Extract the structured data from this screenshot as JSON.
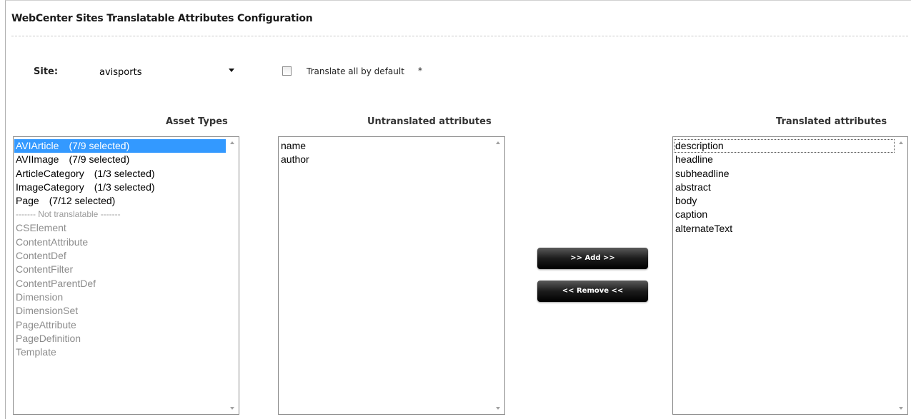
{
  "page": {
    "title": "WebCenter Sites Translatable Attributes Configuration"
  },
  "site": {
    "label": "Site:",
    "selected": "avisports"
  },
  "translate_all": {
    "label": "Translate all by default",
    "star": "*",
    "checked": false
  },
  "asset_types": {
    "header": "Asset Types",
    "translatable": [
      {
        "name": "AVIArticle",
        "count": "(7/9 selected)",
        "selected": true
      },
      {
        "name": "AVIImage",
        "count": "(7/9 selected)",
        "selected": false
      },
      {
        "name": "ArticleCategory",
        "count": "(1/3 selected)",
        "selected": false
      },
      {
        "name": "ImageCategory",
        "count": "(1/3 selected)",
        "selected": false
      },
      {
        "name": "Page",
        "count": "(7/12 selected)",
        "selected": false
      }
    ],
    "separator": "------- Not translatable -------",
    "not_translatable": [
      "CSElement",
      "ContentAttribute",
      "ContentDef",
      "ContentFilter",
      "ContentParentDef",
      "Dimension",
      "DimensionSet",
      "PageAttribute",
      "PageDefinition",
      "Template"
    ]
  },
  "untranslated": {
    "header": "Untranslated attributes",
    "items": [
      "name",
      "author"
    ]
  },
  "translated": {
    "header": "Translated attributes",
    "items": [
      "description",
      "headline",
      "subheadline",
      "abstract",
      "body",
      "caption",
      "alternateText"
    ]
  },
  "buttons": {
    "add": ">> Add >>",
    "remove": "<< Remove <<"
  },
  "colors": {
    "selection": "#3399ff",
    "disabled_text": "#8c8c8c",
    "button_bg": "#000000"
  }
}
